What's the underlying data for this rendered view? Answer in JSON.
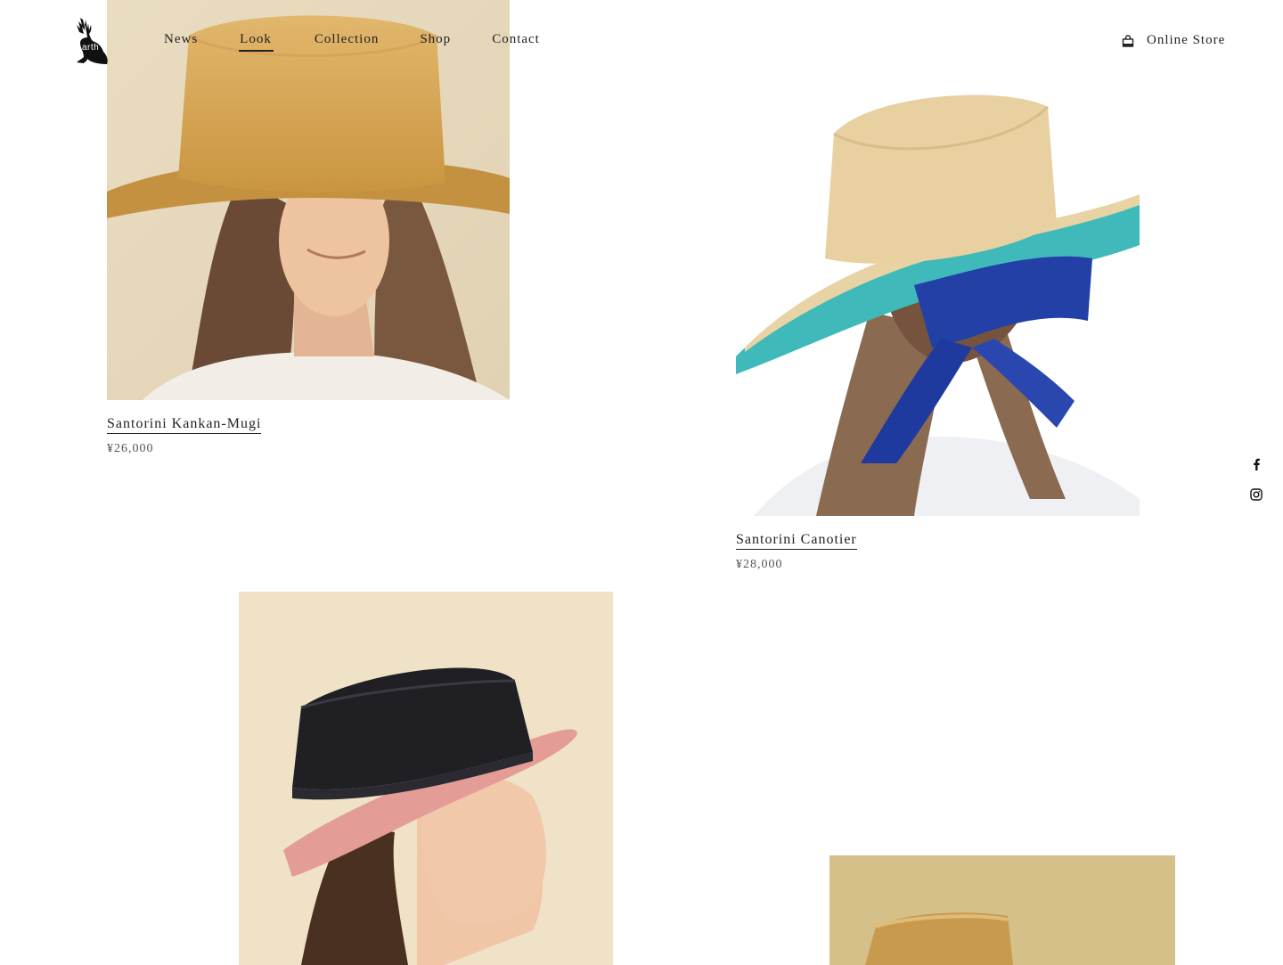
{
  "brand": {
    "logo_text": "arth"
  },
  "nav": {
    "items": [
      {
        "label": "News",
        "active": false
      },
      {
        "label": "Look",
        "active": true
      },
      {
        "label": "Collection",
        "active": false
      },
      {
        "label": "Shop",
        "active": false
      },
      {
        "label": "Contact",
        "active": false
      }
    ]
  },
  "store": {
    "label": "Online Store",
    "icon": "shopping-bag-icon"
  },
  "social": {
    "icons": [
      "facebook-icon",
      "instagram-icon"
    ]
  },
  "products": [
    {
      "name": "Santorini Kankan-Mugi",
      "price": "¥26,000",
      "image": "woman-straw-boater-hat"
    },
    {
      "name": "Santorini Canotier",
      "price": "¥28,000",
      "image": "woman-back-straw-hat-blue-ribbon"
    },
    {
      "image": "woman-black-straw-hat-pink-brim"
    },
    {
      "image": "straw-hat-top"
    }
  ]
}
